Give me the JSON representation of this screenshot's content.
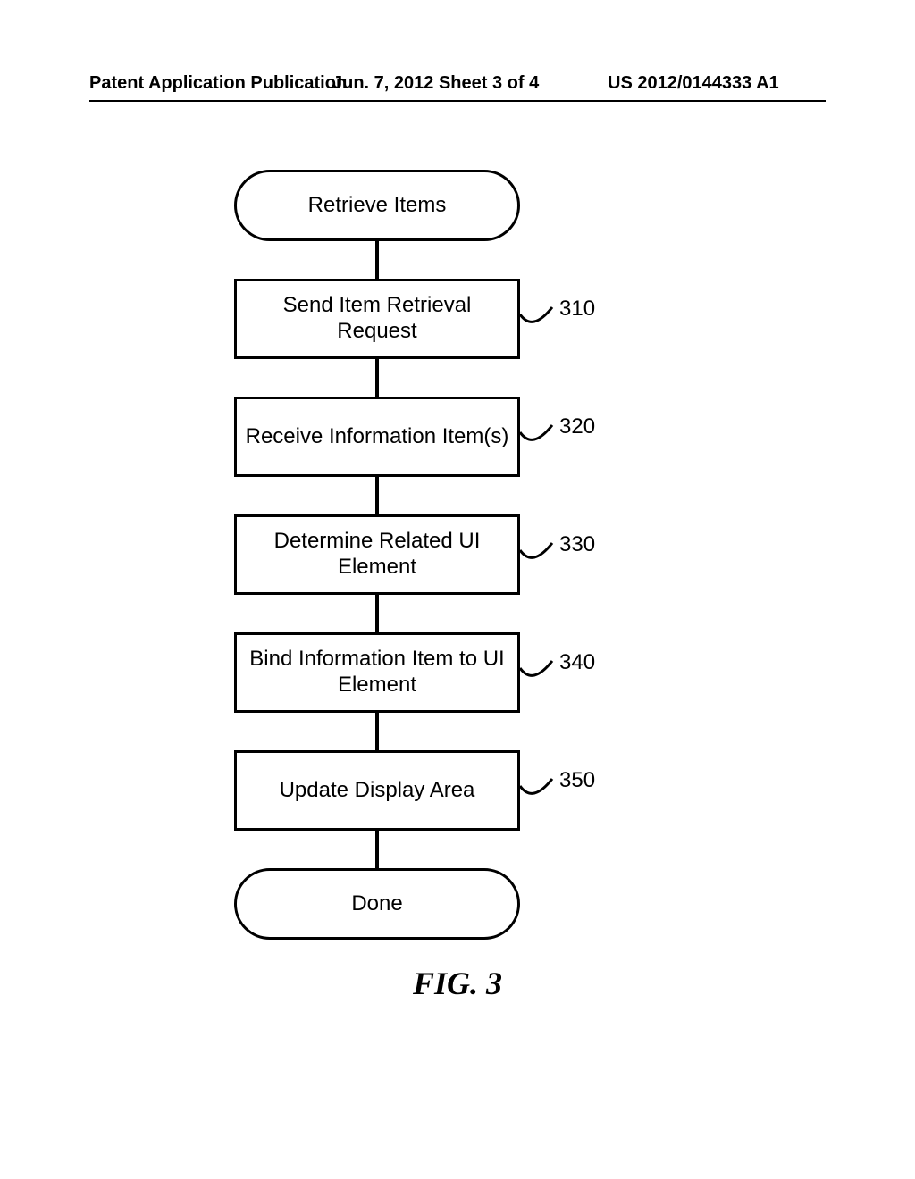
{
  "header": {
    "left": "Patent Application Publication",
    "center": "Jun. 7, 2012  Sheet 3 of 4",
    "right": "US 2012/0144333 A1"
  },
  "chart_data": {
    "type": "flowchart",
    "title": "FIG. 3",
    "nodes": [
      {
        "id": "start",
        "kind": "terminator",
        "label": "Retrieve Items"
      },
      {
        "id": "n310",
        "kind": "process",
        "label": "Send Item Retrieval Request",
        "ref": "310"
      },
      {
        "id": "n320",
        "kind": "process",
        "label": "Receive Information Item(s)",
        "ref": "320"
      },
      {
        "id": "n330",
        "kind": "process",
        "label": "Determine Related UI Element",
        "ref": "330"
      },
      {
        "id": "n340",
        "kind": "process",
        "label": "Bind Information Item to UI Element",
        "ref": "340"
      },
      {
        "id": "n350",
        "kind": "process",
        "label": "Update Display Area",
        "ref": "350"
      },
      {
        "id": "end",
        "kind": "terminator",
        "label": "Done"
      }
    ],
    "edges": [
      [
        "start",
        "n310"
      ],
      [
        "n310",
        "n320"
      ],
      [
        "n320",
        "n330"
      ],
      [
        "n330",
        "n340"
      ],
      [
        "n340",
        "n350"
      ],
      [
        "n350",
        "end"
      ]
    ]
  },
  "figure_label": "FIG. 3"
}
